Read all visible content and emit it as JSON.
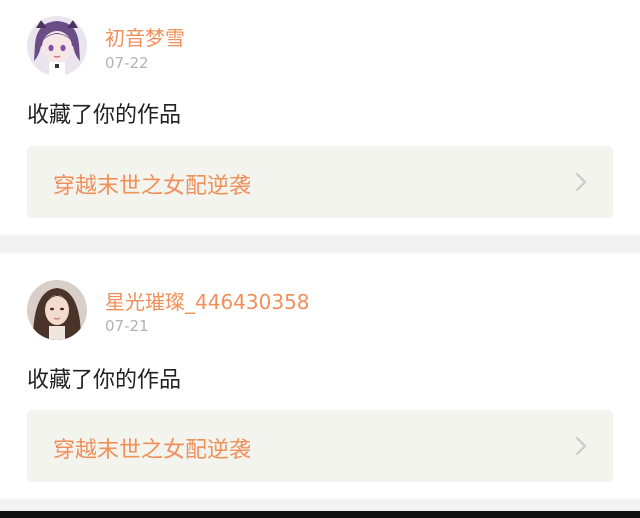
{
  "notifications": [
    {
      "username": "初音梦雪",
      "date": "07-22",
      "action": "收藏了你的作品",
      "work_title": "穿越末世之女配逆袭",
      "avatar": "anime-avatar-icon"
    },
    {
      "username": "星光璀璨_446430358",
      "date": "07-21",
      "action": "收藏了你的作品",
      "work_title": "穿越末世之女配逆袭",
      "avatar": "photo-avatar-icon"
    }
  ],
  "colors": {
    "accent": "#f0905a",
    "date": "#b3b3b3",
    "text": "#222222",
    "work_bg": "#f4f4ef",
    "page_bg": "#f2f2f2"
  }
}
